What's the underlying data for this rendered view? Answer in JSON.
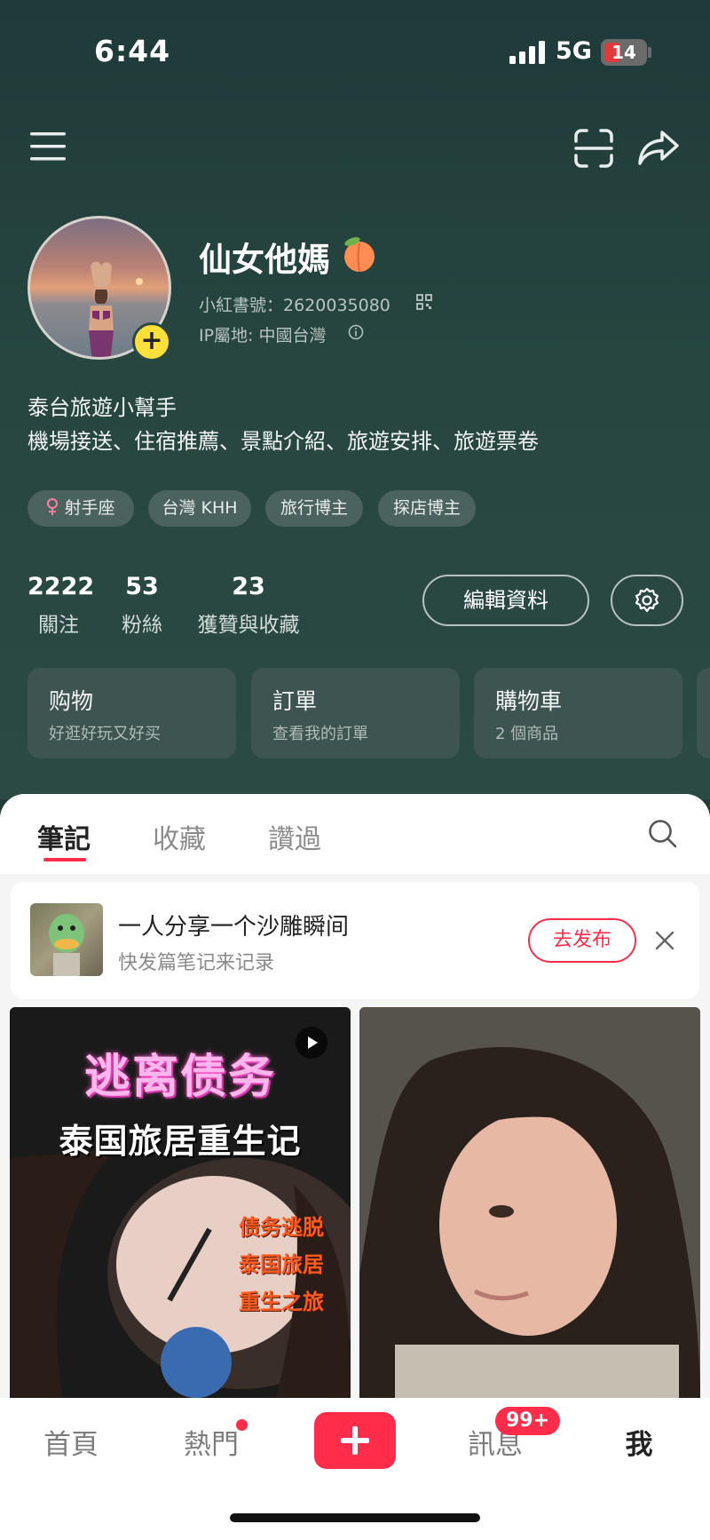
{
  "status_bar": {
    "time": "6:44",
    "network": "5G",
    "battery": "14"
  },
  "profile": {
    "name": "仙女他媽",
    "xhs_id": "小紅書號：2620035080",
    "ip_location": "IP屬地: 中國台灣",
    "bio_line1": "泰台旅遊小幫手",
    "bio_line2": "機場接送、住宿推薦、景點介紹、旅遊安排、旅遊票卷",
    "tags": [
      "射手座",
      "台灣 KHH",
      "旅行博主",
      "探店博主"
    ]
  },
  "stats": [
    {
      "value": "2222",
      "label": "關注"
    },
    {
      "value": "53",
      "label": "粉絲"
    },
    {
      "value": "23",
      "label": "獲贊與收藏"
    }
  ],
  "actions": {
    "edit_profile": "編輯資料"
  },
  "cards": [
    {
      "title": "购物",
      "subtitle": "好逛好玩又好买"
    },
    {
      "title": "訂單",
      "subtitle": "查看我的訂單"
    },
    {
      "title": "購物車",
      "subtitle": "2 個商品"
    }
  ],
  "content_tabs": [
    "筆記",
    "收藏",
    "讚過"
  ],
  "promo": {
    "title": "一人分享一个沙雕瞬间",
    "subtitle": "快发篇笔记来记录",
    "button": "去发布"
  },
  "notes": {
    "note1": {
      "title1": "逃离债务",
      "title2": "泰国旅居重生记",
      "bullets": [
        "债务逃脱",
        "泰国旅居",
        "重生之旅"
      ]
    }
  },
  "bottom_nav": {
    "home": "首頁",
    "hot": "熱門",
    "messages": "訊息",
    "me": "我",
    "messages_badge": "99+"
  },
  "colors": {
    "accent": "#ff2d4a",
    "header_bg": "#274640",
    "avatar_badge": "#ffe03a"
  },
  "icons": [
    "menu-icon",
    "scan-icon",
    "share-icon",
    "qrcode-icon",
    "info-icon",
    "female-icon",
    "settings-icon",
    "search-icon",
    "close-icon",
    "play-icon",
    "plus-icon"
  ]
}
